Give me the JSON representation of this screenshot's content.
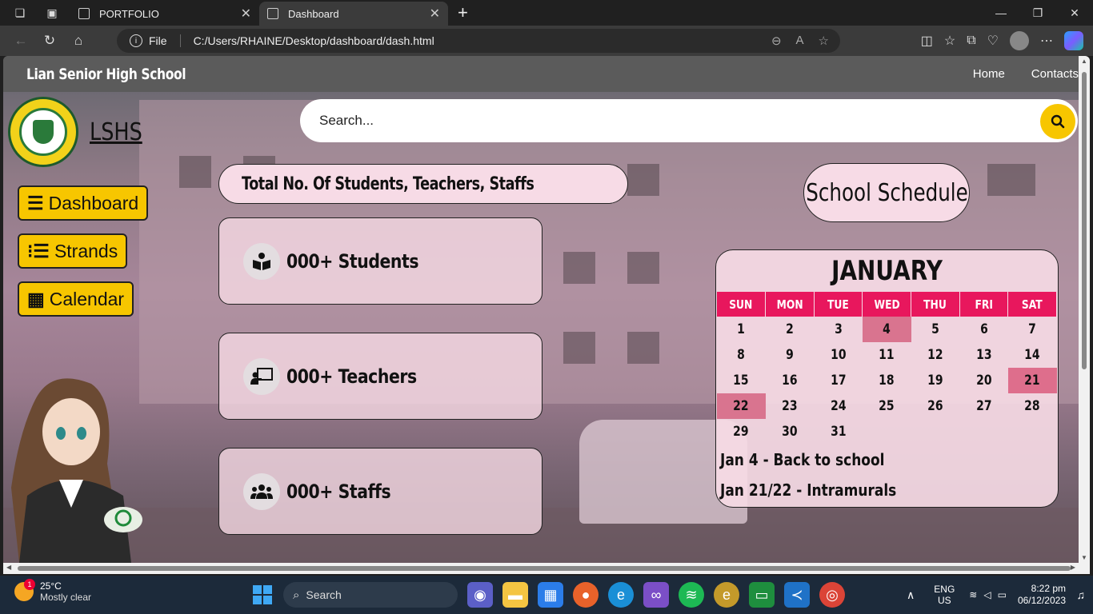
{
  "browser": {
    "tabs": [
      {
        "title": "PORTFOLIO"
      },
      {
        "title": "Dashboard"
      }
    ],
    "address": {
      "scheme_label": "File",
      "url": "C:/Users/RHAINE/Desktop/dashboard/dash.html"
    }
  },
  "site": {
    "brand": "Lian Senior High School",
    "nav": {
      "home": "Home",
      "contacts": "Contacts"
    },
    "logo_text": "LSHS",
    "sidebar": [
      {
        "label": "Dashboard",
        "icon": "bars-icon"
      },
      {
        "label": "Strands",
        "icon": "list-icon"
      },
      {
        "label": "Calendar",
        "icon": "calendar-icon"
      }
    ],
    "search": {
      "placeholder": "Search..."
    },
    "total_title": "Total No. Of Students, Teachers, Staffs",
    "cards": [
      {
        "label": "000+ Students",
        "icon": "book-reader-icon"
      },
      {
        "label": "000+ Teachers",
        "icon": "chalkboard-teacher-icon"
      },
      {
        "label": "000+ Staffs",
        "icon": "users-icon"
      }
    ],
    "schedule_title": "School Schedule",
    "calendar": {
      "month": "JANUARY",
      "days": [
        "SUN",
        "MON",
        "TUE",
        "WED",
        "THU",
        "FRI",
        "SAT"
      ],
      "weeks": [
        [
          "1",
          "2",
          "3",
          "4",
          "5",
          "6",
          "7"
        ],
        [
          "8",
          "9",
          "10",
          "11",
          "12",
          "13",
          "14"
        ],
        [
          "15",
          "16",
          "17",
          "18",
          "19",
          "20",
          "21"
        ],
        [
          "22",
          "23",
          "24",
          "25",
          "26",
          "27",
          "28"
        ],
        [
          "29",
          "30",
          "31",
          "",
          "",
          "",
          ""
        ]
      ],
      "highlighted": [
        "4",
        "21",
        "22"
      ],
      "events": [
        "Jan 4 - Back to school",
        "Jan 21/22 - Intramurals"
      ]
    }
  },
  "taskbar": {
    "weather": {
      "temp": "25°C",
      "desc": "Mostly clear",
      "badge": "1"
    },
    "search_label": "Search",
    "lang": {
      "line1": "ENG",
      "line2": "US"
    },
    "clock": {
      "time": "8:22 pm",
      "date": "06/12/2023"
    }
  },
  "colors": {
    "accent_yellow": "#f7c600",
    "calendar_header": "#e8175d",
    "card_pink": "#f7dbe6"
  }
}
